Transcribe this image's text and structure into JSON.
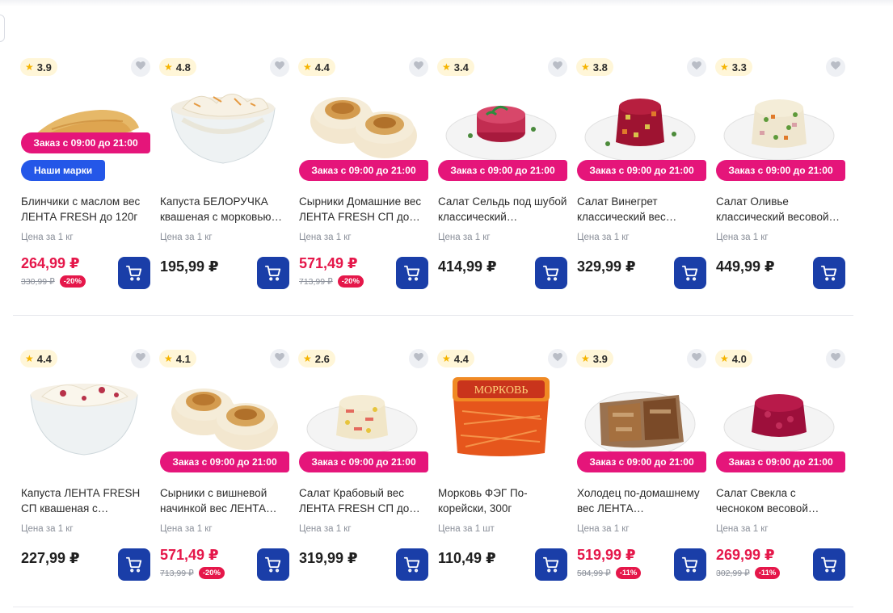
{
  "colors": {
    "promo": "#e5157a",
    "brand_badge": "#2457e8",
    "cart_button": "#1a3ea8",
    "sale_price": "#e5174a",
    "rating_star": "#f5b400"
  },
  "icons": {
    "rating": "star-icon",
    "favorite": "heart-icon",
    "cart": "cart-icon"
  },
  "rows": [
    {
      "products": [
        {
          "rating": "3.9",
          "image": "pancakes",
          "promo": "Заказ с 09:00 до 21:00",
          "promo_pos": "high",
          "brand": "Наши марки",
          "name": "Блинчики с маслом вес ЛЕНТА FRESH до 120г",
          "unit": "Цена за 1 кг",
          "price": "264,99 ₽",
          "old_price": "330,99 ₽",
          "discount": "-20%"
        },
        {
          "rating": "4.8",
          "image": "cabbage",
          "name": "Капуста БЕЛОРУЧКА квашеная с морковью…",
          "unit": "Цена за 1 кг",
          "price": "195,99 ₽"
        },
        {
          "rating": "4.4",
          "image": "syrniki",
          "promo": "Заказ с 09:00 до 21:00",
          "promo_pos": "low",
          "name": "Сырники Домашние вес ЛЕНТА FRESH СП до…",
          "unit": "Цена за 1 кг",
          "price": "571,49 ₽",
          "old_price": "713,99 ₽",
          "discount": "-20%"
        },
        {
          "rating": "3.4",
          "image": "herring",
          "promo": "Заказ с 09:00 до 21:00",
          "promo_pos": "low",
          "name": "Салат Сельдь под шубой классический…",
          "unit": "Цена за 1 кг",
          "price": "414,99 ₽"
        },
        {
          "rating": "3.8",
          "image": "vinegret",
          "promo": "Заказ с 09:00 до 21:00",
          "promo_pos": "low",
          "name": "Салат Винегрет классический вес…",
          "unit": "Цена за 1 кг",
          "price": "329,99 ₽"
        },
        {
          "rating": "3.3",
          "image": "olivier",
          "promo": "Заказ с 09:00 до 21:00",
          "promo_pos": "low",
          "name": "Салат Оливье классический весовой…",
          "unit": "Цена за 1 кг",
          "price": "449,99 ₽"
        }
      ]
    },
    {
      "products": [
        {
          "rating": "4.4",
          "image": "cabbage2",
          "name": "Капуста ЛЕНТА FRESH СП квашеная с…",
          "unit": "Цена за 1 кг",
          "price": "227,99 ₽"
        },
        {
          "rating": "4.1",
          "image": "syrniki",
          "promo": "Заказ с 09:00 до 21:00",
          "promo_pos": "low",
          "name": "Сырники с вишневой начинкой вес ЛЕНТА…",
          "unit": "Цена за 1 кг",
          "price": "571,49 ₽",
          "old_price": "713,99 ₽",
          "discount": "-20%"
        },
        {
          "rating": "2.6",
          "image": "crab",
          "promo": "Заказ с 09:00 до 21:00",
          "promo_pos": "low",
          "name": "Салат Крабовый вес ЛЕНТА FRESH СП до…",
          "unit": "Цена за 1 кг",
          "price": "319,99 ₽"
        },
        {
          "rating": "4.4",
          "image": "carrot",
          "package_label": "Морковь",
          "name": "Морковь ФЭГ По-корейски, 300г",
          "unit": "Цена за 1 шт",
          "price": "110,49 ₽"
        },
        {
          "rating": "3.9",
          "image": "kholodets",
          "promo": "Заказ с 09:00 до 21:00",
          "promo_pos": "low",
          "name": "Холодец по-домашнему вес ЛЕНТА…",
          "unit": "Цена за 1 кг",
          "price": "519,99 ₽",
          "old_price": "584,99 ₽",
          "discount": "-11%"
        },
        {
          "rating": "4.0",
          "image": "beet",
          "promo": "Заказ с 09:00 до 21:00",
          "promo_pos": "low",
          "name": "Салат Свекла с чесноком весовой…",
          "unit": "Цена за 1 кг",
          "price": "269,99 ₽",
          "old_price": "302,99 ₽",
          "discount": "-11%"
        }
      ]
    }
  ]
}
